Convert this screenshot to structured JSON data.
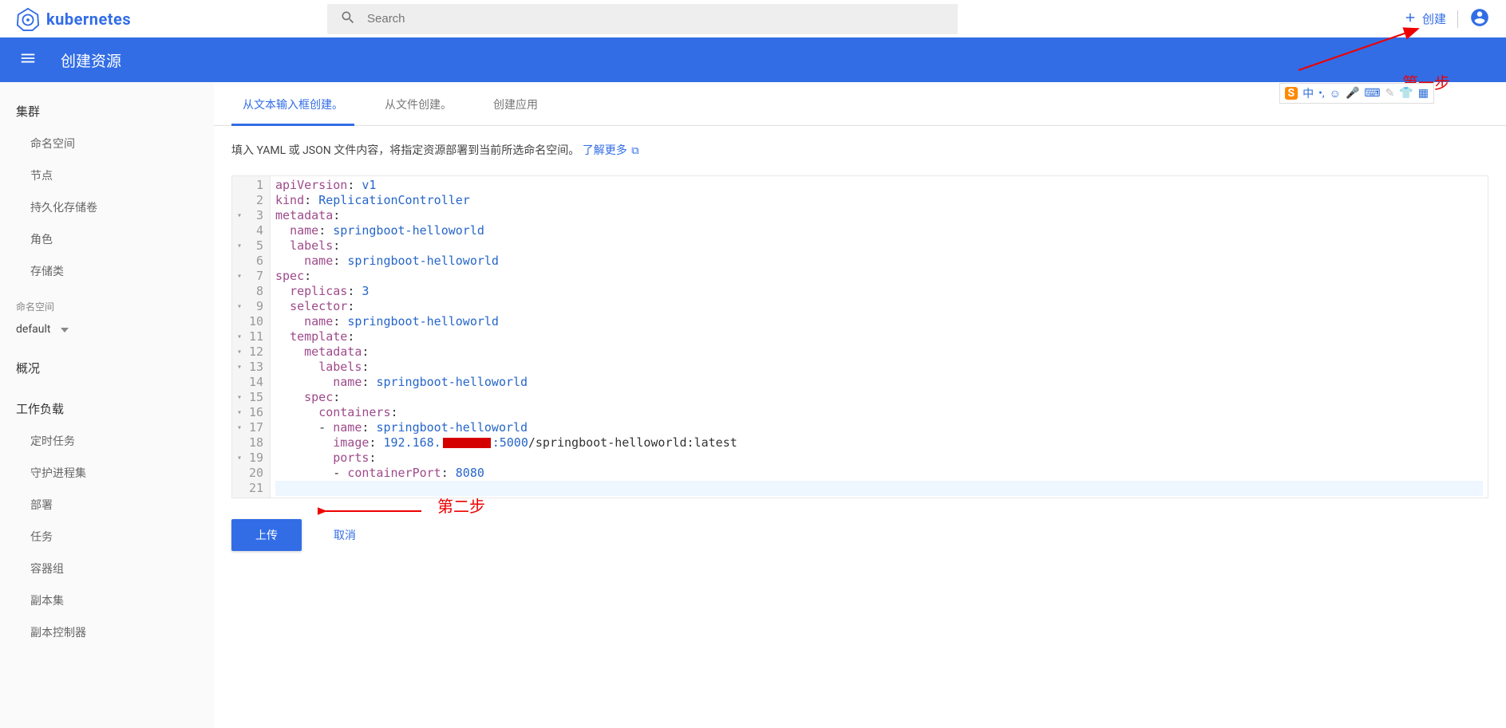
{
  "header": {
    "product": "kubernetes",
    "search_placeholder": "Search",
    "create_label": "创建"
  },
  "annotations": {
    "step1": "第一步",
    "step2": "第二步"
  },
  "titlebar": {
    "title": "创建资源"
  },
  "sidebar": {
    "cluster_header": "集群",
    "cluster_items": [
      "命名空间",
      "节点",
      "持久化存储卷",
      "角色",
      "存储类"
    ],
    "namespace_label": "命名空间",
    "namespace_value": "default",
    "overview_header": "概况",
    "workloads_header": "工作负载",
    "workload_items": [
      "定时任务",
      "守护进程集",
      "部署",
      "任务",
      "容器组",
      "副本集",
      "副本控制器"
    ]
  },
  "tabs": {
    "text_input": "从文本输入框创建。",
    "from_file": "从文件创建。",
    "create_app": "创建应用"
  },
  "instruction": {
    "text": "填入 YAML 或 JSON 文件内容，将指定资源部署到当前所选命名空间。",
    "learn_more": "了解更多"
  },
  "editor": {
    "lines": [
      {
        "n": 1,
        "raw": "apiVersion: v1"
      },
      {
        "n": 2,
        "raw": "kind: ReplicationController"
      },
      {
        "n": 3,
        "fold": true,
        "raw": "metadata:"
      },
      {
        "n": 4,
        "raw": "  name: springboot-helloworld"
      },
      {
        "n": 5,
        "fold": true,
        "raw": "  labels:"
      },
      {
        "n": 6,
        "raw": "    name: springboot-helloworld"
      },
      {
        "n": 7,
        "fold": true,
        "raw": "spec:"
      },
      {
        "n": 8,
        "raw": "  replicas: 3"
      },
      {
        "n": 9,
        "fold": true,
        "raw": "  selector:"
      },
      {
        "n": 10,
        "raw": "    name: springboot-helloworld"
      },
      {
        "n": 11,
        "fold": true,
        "raw": "  template:"
      },
      {
        "n": 12,
        "fold": true,
        "raw": "    metadata:"
      },
      {
        "n": 13,
        "fold": true,
        "raw": "      labels:"
      },
      {
        "n": 14,
        "raw": "        name: springboot-helloworld"
      },
      {
        "n": 15,
        "fold": true,
        "raw": "    spec:"
      },
      {
        "n": 16,
        "fold": true,
        "raw": "      containers:"
      },
      {
        "n": 17,
        "fold": true,
        "raw": "      - name: springboot-helloworld"
      },
      {
        "n": 18,
        "raw": "        image: 192.168.[REDACTED]:5000/springboot-helloworld:latest"
      },
      {
        "n": 19,
        "fold": true,
        "raw": "        ports:"
      },
      {
        "n": 20,
        "raw": "        - containerPort: 8080"
      },
      {
        "n": 21,
        "raw": "",
        "active": true
      }
    ]
  },
  "yaml_content": {
    "apiVersion": "v1",
    "kind": "ReplicationController",
    "metadata": {
      "name": "springboot-helloworld",
      "labels": {
        "name": "springboot-helloworld"
      }
    },
    "spec": {
      "replicas": 3,
      "selector": {
        "name": "springboot-helloworld"
      },
      "template": {
        "metadata": {
          "labels": {
            "name": "springboot-helloworld"
          }
        },
        "spec": {
          "containers": [
            {
              "name": "springboot-helloworld",
              "image": "192.168.[REDACTED]:5000/springboot-helloworld:latest",
              "ports": [
                {
                  "containerPort": 8080
                }
              ]
            }
          ]
        }
      }
    }
  },
  "actions": {
    "upload": "上传",
    "cancel": "取消"
  },
  "ime": {
    "lang": "中",
    "items": [
      "，",
      "☺",
      "🎤",
      "⌨",
      "☕",
      "👕",
      "▦"
    ]
  }
}
